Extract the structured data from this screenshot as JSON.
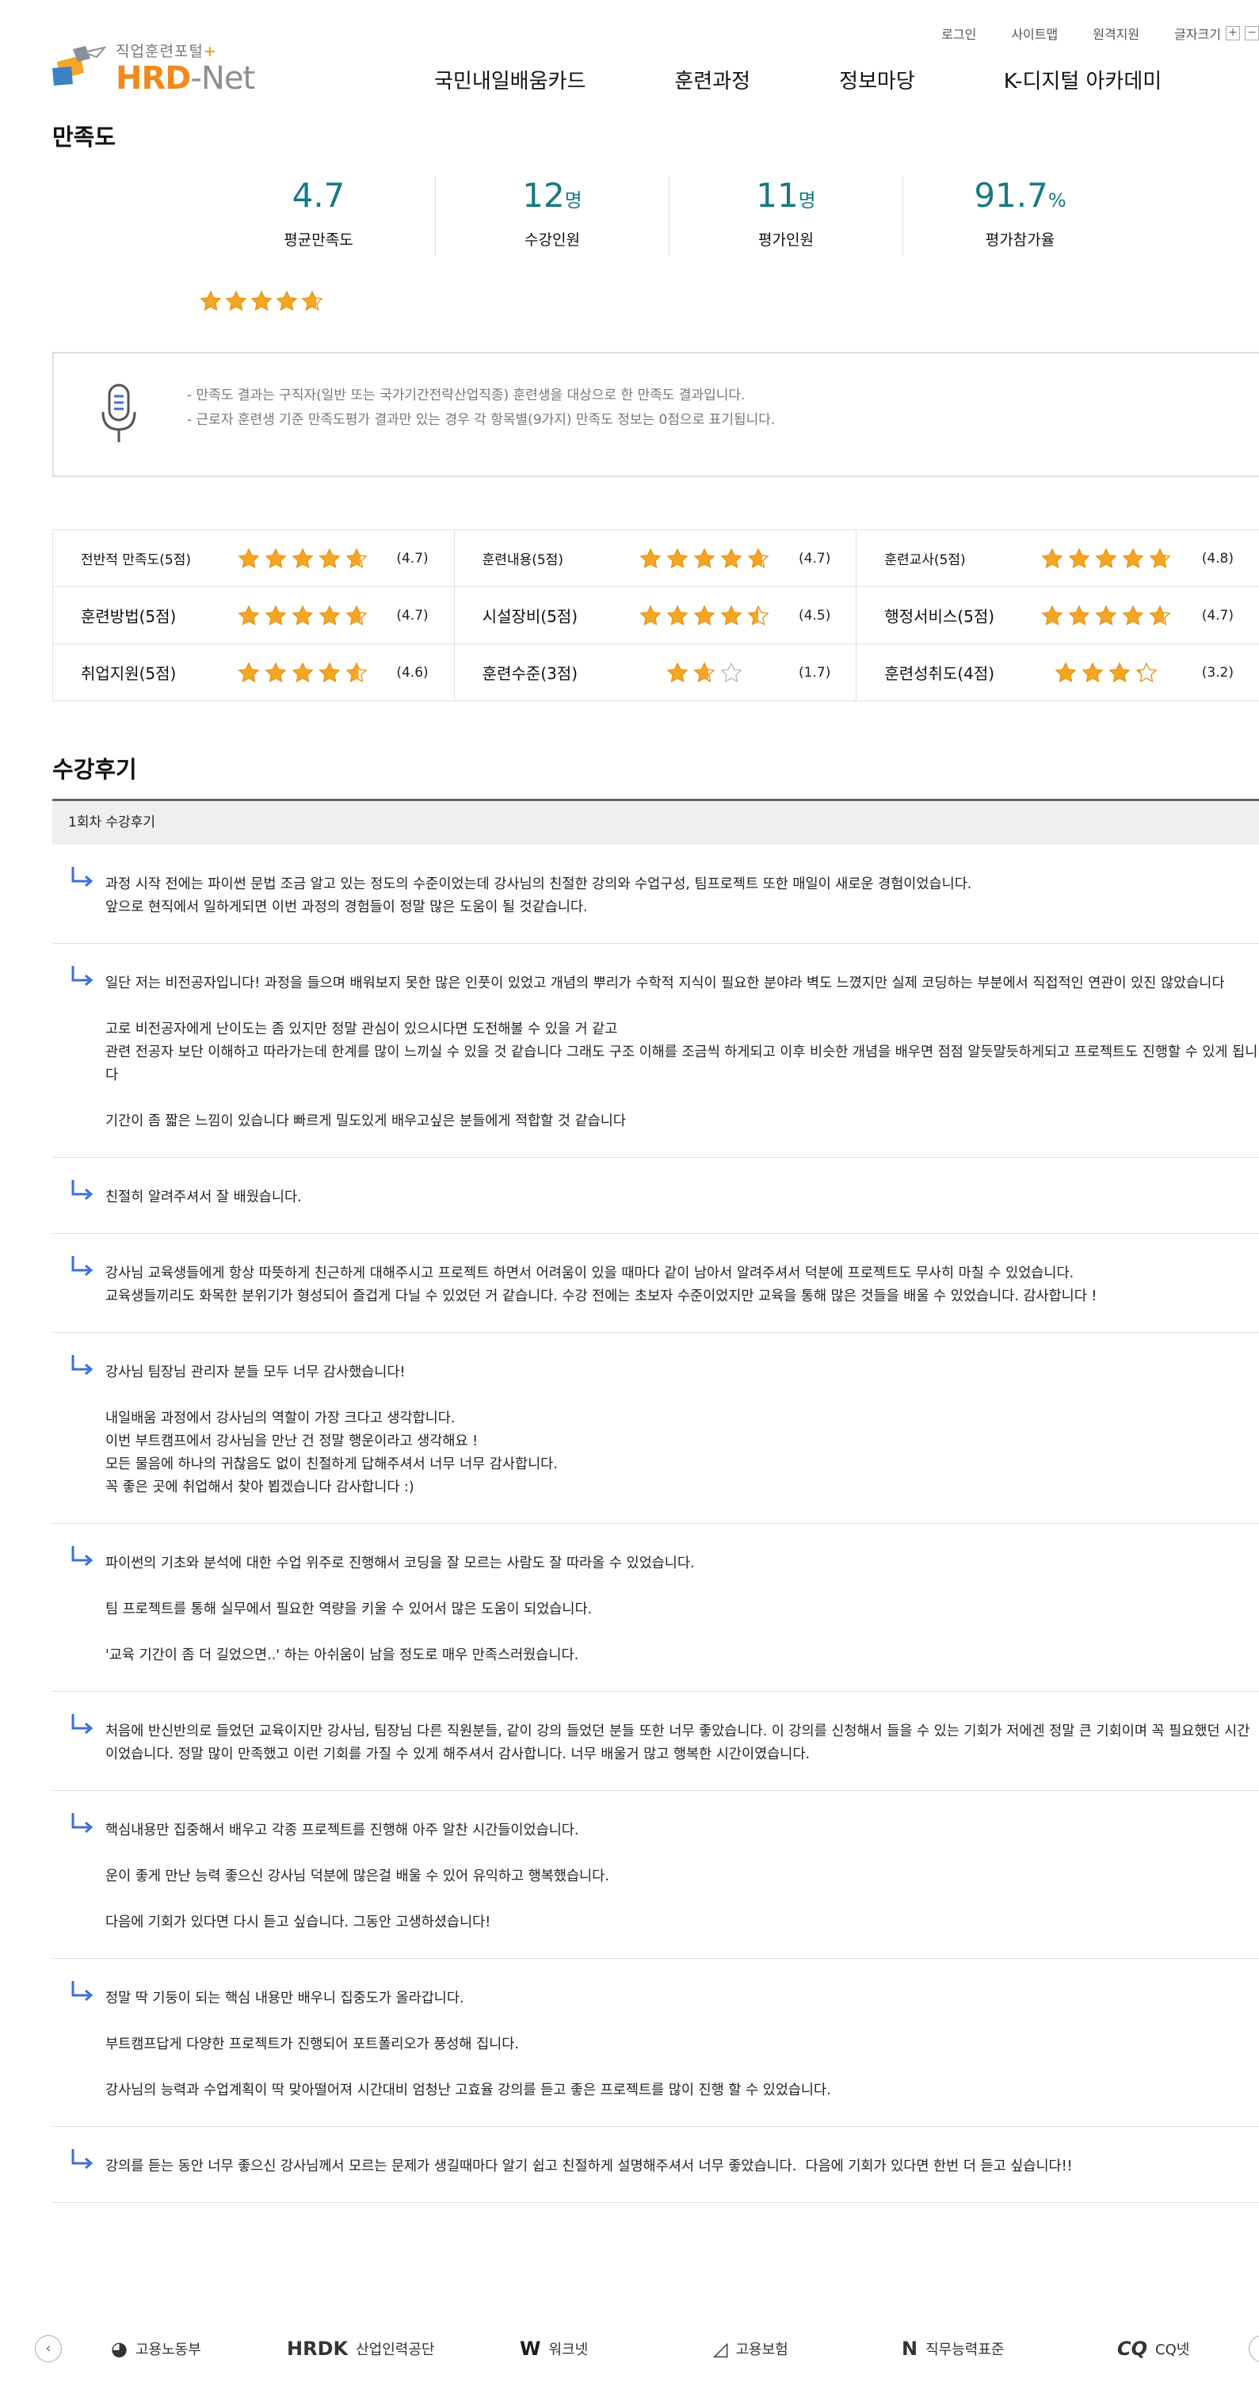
{
  "header": {
    "util_links": [
      "로그인",
      "사이트맵",
      "원격지원",
      "글자크기"
    ],
    "font_plus": "+",
    "font_minus": "−",
    "logo_sub": "직업훈련포털",
    "logo_sub_mark": "+",
    "logo_main_hrd": "HRD",
    "logo_main_net": "-Net",
    "nav": [
      "국민내일배움카드",
      "훈련과정",
      "정보마당",
      "K-디지털 아카데미"
    ]
  },
  "satisfaction": {
    "title": "만족도",
    "stats": [
      {
        "value": "4.7",
        "unit": "",
        "label": "평균만족도"
      },
      {
        "value": "12",
        "unit": "명",
        "label": "수강인원"
      },
      {
        "value": "11",
        "unit": "명",
        "label": "평가인원"
      },
      {
        "value": "91.7",
        "unit": "%",
        "label": "평가참가율"
      }
    ],
    "overall_rating": 4.7,
    "notice": [
      "- 만족도 결과는 구직자(일반 또는 국가기간전략산업직종) 훈련생을 대상으로 한 만족도 결과입니다.",
      "- 근로자 훈련생 기준 만족도평가 결과만 있는 경우 각 항목별(9가지) 만족도 정보는 0점으로 표기됩니다."
    ],
    "items": [
      [
        {
          "label": "전반적 만족도(5점)",
          "score": "(4.7)",
          "max": 5,
          "rating": 4.7
        },
        {
          "label": "훈련내용(5점)",
          "score": "(4.7)",
          "max": 5,
          "rating": 4.7
        },
        {
          "label": "훈련교사(5점)",
          "score": "(4.8)",
          "max": 5,
          "rating": 4.8
        }
      ],
      [
        {
          "label": "훈련방법(5점)",
          "score": "(4.7)",
          "max": 5,
          "rating": 4.7
        },
        {
          "label": "시설장비(5점)",
          "score": "(4.5)",
          "max": 5,
          "rating": 4.5
        },
        {
          "label": "행정서비스(5점)",
          "score": "(4.7)",
          "max": 5,
          "rating": 4.7
        }
      ],
      [
        {
          "label": "취업지원(5점)",
          "score": "(4.6)",
          "max": 5,
          "rating": 4.6
        },
        {
          "label": "훈련수준(3점)",
          "score": "(1.7)",
          "max": 3,
          "rating": 1.7
        },
        {
          "label": "훈련성취도(4점)",
          "score": "(3.2)",
          "max": 4,
          "rating": 3.2
        }
      ]
    ]
  },
  "reviews": {
    "title": "수강후기",
    "round_label": "1회차 수강후기",
    "items": [
      "과정 시작 전에는 파이썬 문법 조금 알고 있는 정도의 수준이었는데 강사님의 친절한 강의와 수업구성, 팀프로젝트 또한 매일이 새로운 경험이었습니다.\n앞으로 현직에서 일하게되면 이번 과정의 경험들이 정말 많은 도움이 될 것같습니다.",
      "일단 저는 비전공자입니다! 과정을 들으며 배워보지 못한 많은 인풋이 있었고 개념의 뿌리가 수학적 지식이 필요한 분야라 벽도 느꼈지만 실제 코딩하는 부분에서 직접적인 연관이 있진 않았습니다\n\n고로 비전공자에게 난이도는 좀 있지만 정말 관심이 있으시다면 도전해볼 수 있을 거 같고\n관련 전공자 보단 이해하고 따라가는데 한계를 많이 느끼실 수 있을 것 같습니다 그래도 구조 이해를 조금씩 하게되고 이후 비슷한 개념을 배우면 점점 알듯말듯하게되고 프로젝트도 진행할 수 있게 됩니다\n\n기간이 좀 짧은 느낌이 있습니다 빠르게 밀도있게 배우고싶은 분들에게 적합할 것 같습니다",
      "친절히 알려주셔서 잘 배웠습니다.",
      "강사님 교육생들에게 항상 따뜻하게 친근하게 대해주시고 프로젝트 하면서 어려움이 있을 때마다 같이 남아서 알려주셔서 덕분에 프로젝트도 무사히 마칠 수 있었습니다.\n교육생들끼리도 화목한 분위기가 형성되어 즐겁게 다닐 수 있었던 거 같습니다. 수강 전에는 초보자 수준이었지만 교육을 통해 많은 것들을 배울 수 있었습니다. 감사합니다 !",
      "강사님 팀장님 관리자 분들 모두 너무 감사했습니다!\n\n내일배움 과정에서 강사님의 역할이 가장 크다고 생각합니다.\n이번 부트캠프에서 강사님을 만난 건 정말 행운이라고 생각해요 !\n모든 물음에 하나의 귀찮음도 없이 친절하게 답해주셔서 너무 너무 감사합니다.\n꼭 좋은 곳에 취업해서 찾아 뵙겠습니다 감사합니다 :)",
      "파이썬의 기초와 분석에 대한 수업 위주로 진행해서 코딩을 잘 모르는 사람도 잘 따라올 수 있었습니다.\n\n팀 프로젝트를 통해 실무에서 필요한 역량을 키울 수 있어서 많은 도움이 되었습니다.\n\n'교육 기간이 좀 더 길었으면..' 하는 아쉬움이 남을 정도로 매우 만족스러웠습니다.",
      "처음에 반신반의로 들었던 교육이지만 강사님, 팀장님 다른 직원분들, 같이 강의 들었던 분들 또한 너무 좋았습니다. 이 강의를 신청해서 들을 수 있는 기회가 저에겐 정말 큰 기회이며 꼭 필요했던 시간이었습니다. 정말 많이 만족했고 이런 기회를 가질 수 있게 해주셔서 감사합니다. 너무 배울거 많고 행복한 시간이였습니다.",
      "핵심내용만 집중해서 배우고 각종 프로젝트를 진행해 아주 알찬 시간들이었습니다.\n\n운이 좋게 만난 능력 좋으신 강사님 덕분에 많은걸 배울 수 있어 유익하고 행복했습니다.\n\n다음에 기회가 있다면 다시 듣고 싶습니다. 그동안 고생하셨습니다!",
      "정말 딱 기둥이 되는 핵심 내용만 배우니 집중도가 올라갑니다.\n\n부트캠프답게 다양한 프로젝트가 진행되어 포트폴리오가 풍성해 집니다.\n\n강사님의 능력과 수업계획이 딱 맞아떨어져 시간대비 엄청난 고효율 강의를 듣고 좋은 프로젝트를 많이 진행 할 수 있었습니다.",
      "강의를 듣는 동안 너무 좋으신 강사님께서 모르는 문제가 생길때마다 알기 쉽고 친절하게 설명해주셔서 너무 좋았습니다.  다음에 기회가 있다면 한번 더 듣고 싶습니다!!"
    ]
  },
  "footer": {
    "prev": "‹",
    "next": "›",
    "orgs": [
      {
        "logo": "◕",
        "name": "고용노동부"
      },
      {
        "logo": "HRDK",
        "name": "산업인력공단"
      },
      {
        "logo": "W",
        "name": "워크넷"
      },
      {
        "logo": "◿",
        "name": "고용보험"
      },
      {
        "logo": "N",
        "name": "직무능력표준"
      },
      {
        "logo": "CQ",
        "name": "CQ넷"
      }
    ]
  },
  "colors": {
    "accent": "#157a82",
    "star": "#f5a623",
    "brand_orange": "#f08a1c",
    "review_arrow": "#3a6fd8"
  }
}
